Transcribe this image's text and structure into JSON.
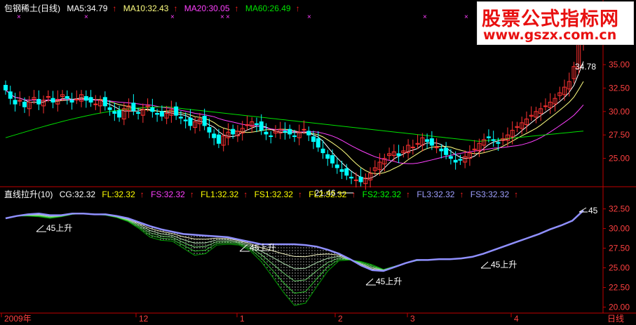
{
  "top_panel": {
    "title": "包钢稀土(日线)",
    "ma5": "MA5:34.79",
    "ma10": "MA10:32.43",
    "ma20": "MA20:30.05",
    "ma60": "MA60:26.49",
    "low_label": "21.46",
    "last_label": "34.78"
  },
  "bottom_panel": {
    "title": "直线拉升(10)",
    "cg": "CG:32.32",
    "fl": "FL:32.32",
    "fs": "FS:32.32",
    "fl1": "FL1:32.32",
    "fs1": "FS1:32.32",
    "fl2": "FL2:32.32",
    "fs2": "FS2:32.32",
    "fl3": "FL3:32.32",
    "fs3": "FS3:32.32",
    "signal_text": "45上升",
    "signal_top": "45"
  },
  "x_axis": {
    "labels": [
      "2009年",
      "12",
      "1",
      "2",
      "3",
      "4"
    ],
    "period_button": "日线"
  },
  "watermark": {
    "title": "股票公式指标网",
    "url": "www.gszx.com.cn"
  },
  "colors": {
    "up": "#ff3232",
    "down": "#00ffff",
    "ma5": "#ffffff",
    "ma10": "#ffff80",
    "ma20": "#ff40ff",
    "ma60": "#00e000",
    "cg": "#9090ff",
    "fl": "#00c000",
    "axis": "#c00000"
  },
  "chart_data": [
    {
      "type": "line",
      "subtype": "candlestick",
      "title": "包钢稀土(日线)",
      "y_ticks": [
        25.0,
        27.5,
        30.0,
        32.5,
        35.0,
        37.5
      ],
      "ylim": [
        22.8,
        39.8
      ],
      "annotations": [
        {
          "text": "21.46",
          "value": 21.46
        },
        {
          "text": "34.78",
          "value": 34.78
        }
      ],
      "closes": [
        32.3,
        31.4,
        30.8,
        31.2,
        30.5,
        31.0,
        31.5,
        30.8,
        31.2,
        31.6,
        31.0,
        31.3,
        31.8,
        31.4,
        31.0,
        31.3,
        31.8,
        31.2,
        31.0,
        30.8,
        31.2,
        30.6,
        30.2,
        29.8,
        29.4,
        30.3,
        30.6,
        30.1,
        29.8,
        30.2,
        30.6,
        30.0,
        29.7,
        29.5,
        29.8,
        30.2,
        29.6,
        29.3,
        29.0,
        28.5,
        28.9,
        29.2,
        28.5,
        27.8,
        27.2,
        26.6,
        27.4,
        27.8,
        27.6,
        27.9,
        28.2,
        28.6,
        28.9,
        28.6,
        28.0,
        27.6,
        27.4,
        27.9,
        28.1,
        27.8,
        27.6,
        27.4,
        27.8,
        28.1,
        27.5,
        26.8,
        26.2,
        25.6,
        25.0,
        24.5,
        24.0,
        23.6,
        23.2,
        22.9,
        22.7,
        22.5,
        22.9,
        23.4,
        24.0,
        24.6,
        25.0,
        25.5,
        25.7,
        25.3,
        25.8,
        26.4,
        26.2,
        26.6,
        27.2,
        26.8,
        26.4,
        26.2,
        25.8,
        25.4,
        25.0,
        24.6,
        24.8,
        25.2,
        25.6,
        26.0,
        26.6,
        27.0,
        27.2,
        26.9,
        26.6,
        27.1,
        27.5,
        28.0,
        28.4,
        28.8,
        29.2,
        29.6,
        30.0,
        30.3,
        30.6,
        31.0,
        31.4,
        32.0,
        32.6,
        33.2,
        34.8,
        37.5,
        38.6
      ]
    },
    {
      "type": "line",
      "title": "直线拉升(10)",
      "y_ticks": [
        20.0,
        22.5,
        25.0,
        27.5,
        30.0,
        32.5
      ],
      "ylim": [
        19.6,
        33.0
      ],
      "series": [
        {
          "name": "CG",
          "values": [
            31.3,
            31.6,
            31.8,
            31.9,
            31.7,
            31.7,
            31.9,
            31.9,
            31.8,
            31.8,
            31.6,
            31.3,
            30.8,
            30.3,
            29.9,
            29.6,
            29.3,
            29.2,
            29.1,
            29.0,
            28.9,
            28.6,
            28.3,
            28.0,
            28.0,
            28.0,
            28.0,
            27.9,
            27.7,
            27.3,
            26.8,
            26.1,
            25.3,
            24.7,
            24.6,
            25.1,
            25.6,
            26.0,
            26.0,
            26.1,
            26.1,
            26.2,
            26.4,
            26.8,
            27.3,
            27.8,
            28.3,
            28.8,
            29.3,
            29.9,
            30.4,
            31.0,
            32.3
          ]
        },
        {
          "name": "FL",
          "values": [
            31.3,
            31.6,
            31.6,
            31.5,
            31.3,
            31.5,
            31.8,
            31.9,
            31.8,
            31.7,
            31.4,
            30.9,
            30.0,
            28.9,
            28.5,
            28.4,
            27.5,
            26.6,
            26.8,
            27.9,
            28.0,
            27.9,
            27.2,
            25.8,
            23.9,
            21.9,
            20.2,
            20.5,
            22.6,
            24.6,
            25.9,
            26.0,
            25.8,
            25.4,
            24.8,
            25.2,
            25.6,
            25.9,
            26.0
          ]
        }
      ]
    }
  ]
}
